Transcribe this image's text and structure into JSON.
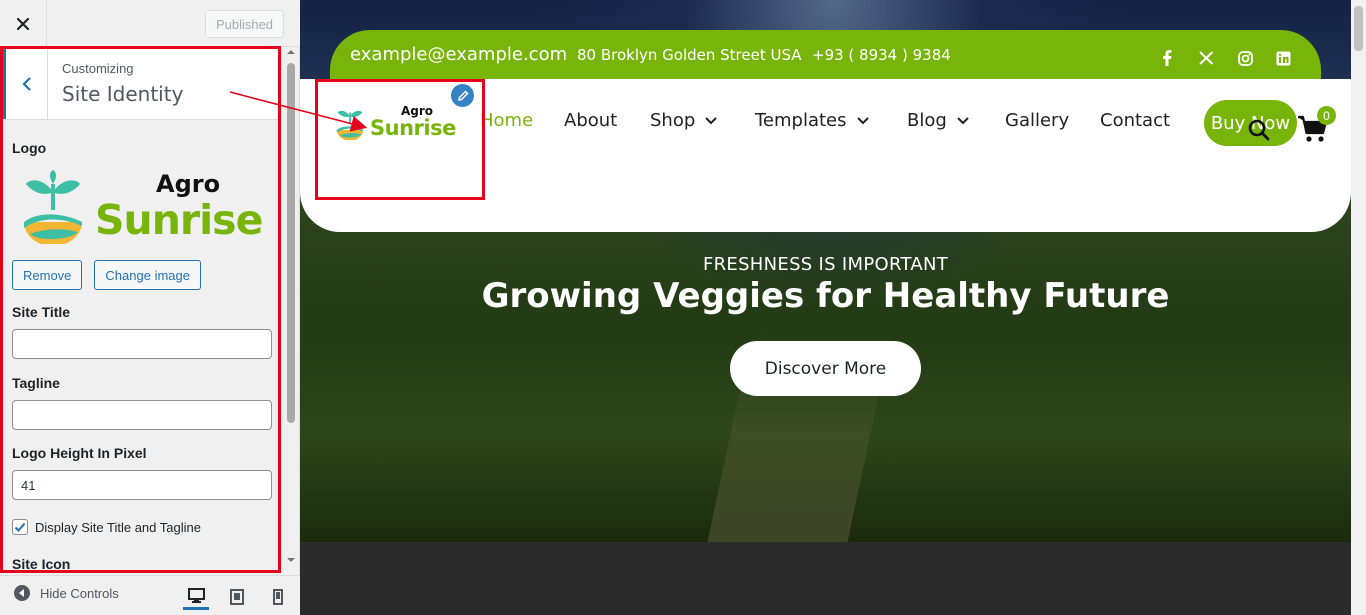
{
  "customizer": {
    "publish_label": "Published",
    "breadcrumb": "Customizing",
    "section_title": "Site Identity",
    "logo_label": "Logo",
    "remove_label": "Remove",
    "change_image_label": "Change image",
    "site_title_label": "Site Title",
    "site_title_value": "",
    "tagline_label": "Tagline",
    "tagline_value": "",
    "logo_height_label": "Logo Height In Pixel",
    "logo_height_value": "41",
    "display_title_label": "Display Site Title and Tagline",
    "display_title_checked": true,
    "site_icon_label": "Site Icon",
    "hide_controls_label": "Hide Controls",
    "devices": [
      "desktop-icon",
      "tablet-icon",
      "mobile-icon"
    ]
  },
  "site": {
    "logo_small": "Agro",
    "logo_big": "Sunrise",
    "email": "example@example.com",
    "address": "80 Broklyn Golden Street USA",
    "phone": "+93 ( 8934 ) 9384",
    "social": [
      "facebook-icon",
      "x-icon",
      "instagram-icon",
      "linkedin-icon"
    ],
    "nav": [
      {
        "label": "Home",
        "active": true
      },
      {
        "label": "About"
      },
      {
        "label": "Shop",
        "dropdown": true
      },
      {
        "label": "Templates",
        "dropdown": true
      },
      {
        "label": "Blog",
        "dropdown": true
      },
      {
        "label": "Gallery"
      },
      {
        "label": "Contact"
      }
    ],
    "buy_now": "Buy Now",
    "cart_count": "0",
    "hero_eyebrow": "FRESHNESS IS IMPORTANT",
    "hero_title": "Growing Veggies for Healthy Future",
    "hero_button": "Discover More"
  },
  "colors": {
    "brand_green": "#78b40a",
    "wp_blue": "#2271b1",
    "highlight_red": "#e5001c",
    "logo_teal": "#3dbfa6",
    "logo_yellow": "#f2b632"
  }
}
